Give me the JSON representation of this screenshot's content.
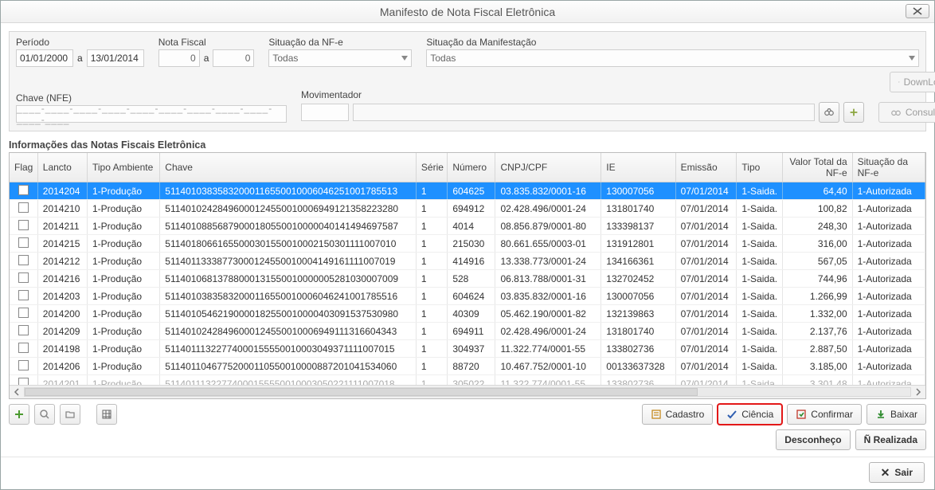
{
  "window": {
    "title": "Manifesto de Nota Fiscal Eletrônica"
  },
  "filters": {
    "periodo_label": "Período",
    "periodo_from": "01/01/2000",
    "periodo_sep": "a",
    "periodo_to": "13/01/2014",
    "nf_label": "Nota Fiscal",
    "nf_from": "0",
    "nf_sep": "a",
    "nf_to": "0",
    "situacao_nfe_label": "Situação da NF-e",
    "situacao_nfe_value": "Todas",
    "manifestacao_label": "Situação da Manifestação",
    "manifestacao_value": "Todas",
    "chave_label": "Chave (NFE)",
    "chave_placeholder": "____-____-____-____-____-____-____-____-____-____-____",
    "movimentador_label": "Movimentador",
    "download_label": "DownLoad",
    "consultar_label": "Consultar"
  },
  "grid": {
    "title": "Informações das Notas Fiscais Eletrônica",
    "headers": {
      "flag": "Flag",
      "lancto": "Lancto",
      "ambiente": "Tipo Ambiente",
      "chave": "Chave",
      "serie": "Série",
      "numero": "Número",
      "cnpj": "CNPJ/CPF",
      "ie": "IE",
      "emissao": "Emissão",
      "tipo": "Tipo",
      "valor": "Valor Total da NF-e",
      "situacao": "Situação da NF-e"
    },
    "rows": [
      {
        "lancto": "2014204",
        "ambiente": "1-Produção",
        "chave": "51140103835832000116550010006046251001785513",
        "serie": "1",
        "numero": "604625",
        "cnpj": "03.835.832/0001-16",
        "ie": "130007056",
        "emissao": "07/01/2014",
        "tipo": "1-Saida.",
        "valor": "64,40",
        "situacao": "1-Autorizada",
        "selected": true
      },
      {
        "lancto": "2014210",
        "ambiente": "1-Produção",
        "chave": "51140102428496000124550010006949121358223280",
        "serie": "1",
        "numero": "694912",
        "cnpj": "02.428.496/0001-24",
        "ie": "131801740",
        "emissao": "07/01/2014",
        "tipo": "1-Saida.",
        "valor": "100,82",
        "situacao": "1-Autorizada"
      },
      {
        "lancto": "2014211",
        "ambiente": "1-Produção",
        "chave": "51140108856879000180550010000040141494697587",
        "serie": "1",
        "numero": "4014",
        "cnpj": "08.856.879/0001-80",
        "ie": "133398137",
        "emissao": "07/01/2014",
        "tipo": "1-Saida.",
        "valor": "248,30",
        "situacao": "1-Autorizada"
      },
      {
        "lancto": "2014215",
        "ambiente": "1-Produção",
        "chave": "51140180661655000301550010002150301111007010",
        "serie": "1",
        "numero": "215030",
        "cnpj": "80.661.655/0003-01",
        "ie": "131912801",
        "emissao": "07/01/2014",
        "tipo": "1-Saida.",
        "valor": "316,00",
        "situacao": "1-Autorizada"
      },
      {
        "lancto": "2014212",
        "ambiente": "1-Produção",
        "chave": "51140113338773000124550010004149161111007019",
        "serie": "1",
        "numero": "414916",
        "cnpj": "13.338.773/0001-24",
        "ie": "134166361",
        "emissao": "07/01/2014",
        "tipo": "1-Saida.",
        "valor": "567,05",
        "situacao": "1-Autorizada"
      },
      {
        "lancto": "2014216",
        "ambiente": "1-Produção",
        "chave": "51140106813788000131550010000005281030007009",
        "serie": "1",
        "numero": "528",
        "cnpj": "06.813.788/0001-31",
        "ie": "132702452",
        "emissao": "07/01/2014",
        "tipo": "1-Saida.",
        "valor": "744,96",
        "situacao": "1-Autorizada"
      },
      {
        "lancto": "2014203",
        "ambiente": "1-Produção",
        "chave": "51140103835832000116550010006046241001785516",
        "serie": "1",
        "numero": "604624",
        "cnpj": "03.835.832/0001-16",
        "ie": "130007056",
        "emissao": "07/01/2014",
        "tipo": "1-Saida.",
        "valor": "1.266,99",
        "situacao": "1-Autorizada"
      },
      {
        "lancto": "2014200",
        "ambiente": "1-Produção",
        "chave": "51140105462190000182550010000403091537530980",
        "serie": "1",
        "numero": "40309",
        "cnpj": "05.462.190/0001-82",
        "ie": "132139863",
        "emissao": "07/01/2014",
        "tipo": "1-Saida.",
        "valor": "1.332,00",
        "situacao": "1-Autorizada"
      },
      {
        "lancto": "2014209",
        "ambiente": "1-Produção",
        "chave": "51140102428496000124550010006949111316604343",
        "serie": "1",
        "numero": "694911",
        "cnpj": "02.428.496/0001-24",
        "ie": "131801740",
        "emissao": "07/01/2014",
        "tipo": "1-Saida.",
        "valor": "2.137,76",
        "situacao": "1-Autorizada"
      },
      {
        "lancto": "2014198",
        "ambiente": "1-Produção",
        "chave": "51140111322774000155550010003049371111007015",
        "serie": "1",
        "numero": "304937",
        "cnpj": "11.322.774/0001-55",
        "ie": "133802736",
        "emissao": "07/01/2014",
        "tipo": "1-Saida.",
        "valor": "2.887,50",
        "situacao": "1-Autorizada"
      },
      {
        "lancto": "2014206",
        "ambiente": "1-Produção",
        "chave": "51140110467752000110550010000887201041534060",
        "serie": "1",
        "numero": "88720",
        "cnpj": "10.467.752/0001-10",
        "ie": "00133637328",
        "emissao": "07/01/2014",
        "tipo": "1-Saida.",
        "valor": "3.185,00",
        "situacao": "1-Autorizada"
      }
    ],
    "partial_row": {
      "lancto": "2014201",
      "ambiente": "1-Produção",
      "chave": "51140111322774000155550010003050221111007018",
      "serie": "1",
      "numero": "305022",
      "cnpj": "11.322.774/0001-55",
      "ie": "133802736",
      "emissao": "07/01/2014",
      "tipo": "1-Saida.",
      "valor": "3.301,48",
      "situacao": "1-Autorizada"
    }
  },
  "buttons": {
    "cadastro": "Cadastro",
    "ciencia": "Ciência",
    "confirmar": "Confirmar",
    "baixar": "Baixar",
    "desconheco": "Desconheço",
    "nrealizada": "Ñ Realizada",
    "sair": "Sair"
  }
}
